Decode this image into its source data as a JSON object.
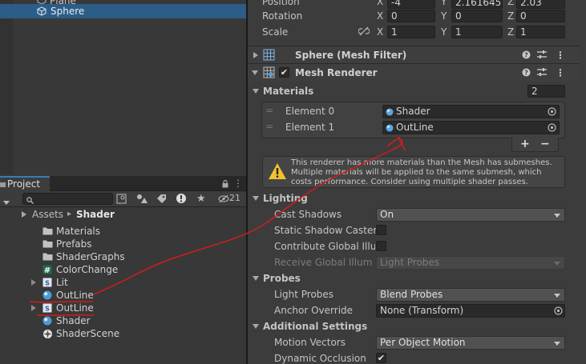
{
  "hierarchy": {
    "items": [
      {
        "label": "Plane"
      },
      {
        "label": "Sphere",
        "selected": true
      }
    ]
  },
  "project": {
    "tab_label": "Project",
    "counter": "21",
    "breadcrumb": {
      "root": "Assets",
      "sep": "▸",
      "current": "Shader"
    },
    "items": [
      {
        "label": "Materials",
        "icon": "folder-icon"
      },
      {
        "label": "Prefabs",
        "icon": "folder-icon"
      },
      {
        "label": "ShaderGraphs",
        "icon": "folder-icon"
      },
      {
        "label": "ColorChange",
        "icon": "script-icon"
      },
      {
        "label": "Lit",
        "icon": "shader-icon"
      },
      {
        "label": "OutLine",
        "icon": "material-icon"
      },
      {
        "label": "OutLine",
        "icon": "shader-icon"
      },
      {
        "label": "Shader",
        "icon": "material-icon"
      },
      {
        "label": "ShaderScene",
        "icon": "scene-icon"
      }
    ]
  },
  "inspector": {
    "transform": {
      "position": {
        "label": "Position",
        "x": "-4",
        "y": "2.161645",
        "z": "2.03"
      },
      "rotation": {
        "label": "Rotation",
        "x": "0",
        "y": "0",
        "z": "0"
      },
      "scale": {
        "label": "Scale",
        "x": "1",
        "y": "1",
        "z": "1"
      },
      "axis_x": "X",
      "axis_y": "Y",
      "axis_z": "Z"
    },
    "mesh_filter": {
      "title": "Sphere (Mesh Filter)"
    },
    "mesh_renderer": {
      "title": "Mesh Renderer",
      "materials": {
        "label": "Materials",
        "count": "2",
        "elements": [
          {
            "label": "Element 0",
            "value": "Shader"
          },
          {
            "label": "Element 1",
            "value": "OutLine"
          }
        ],
        "add": "+",
        "remove": "−"
      },
      "warning": "This renderer has more materials than the Mesh has submeshes. Multiple materials will be applied to the same submesh, which costs performance. Consider using multiple shader passes.",
      "lighting": {
        "label": "Lighting",
        "cast_shadows": {
          "label": "Cast Shadows",
          "value": "On"
        },
        "static_shadow_caster": {
          "label": "Static Shadow Caster"
        },
        "contribute_gi": {
          "label": "Contribute Global Illum"
        },
        "receive_gi": {
          "label": "Receive Global Illum",
          "value": "Light Probes"
        }
      },
      "probes": {
        "label": "Probes",
        "light_probes": {
          "label": "Light Probes",
          "value": "Blend Probes"
        },
        "anchor_override": {
          "label": "Anchor Override",
          "value": "None (Transform)"
        }
      },
      "additional": {
        "label": "Additional Settings",
        "motion_vectors": {
          "label": "Motion Vectors",
          "value": "Per Object Motion"
        },
        "dynamic_occlusion": {
          "label": "Dynamic Occlusion"
        }
      }
    }
  },
  "colors": {
    "selection": "#2c5d87",
    "annotation": "#d21c1c",
    "warning": "#f2c12e"
  }
}
